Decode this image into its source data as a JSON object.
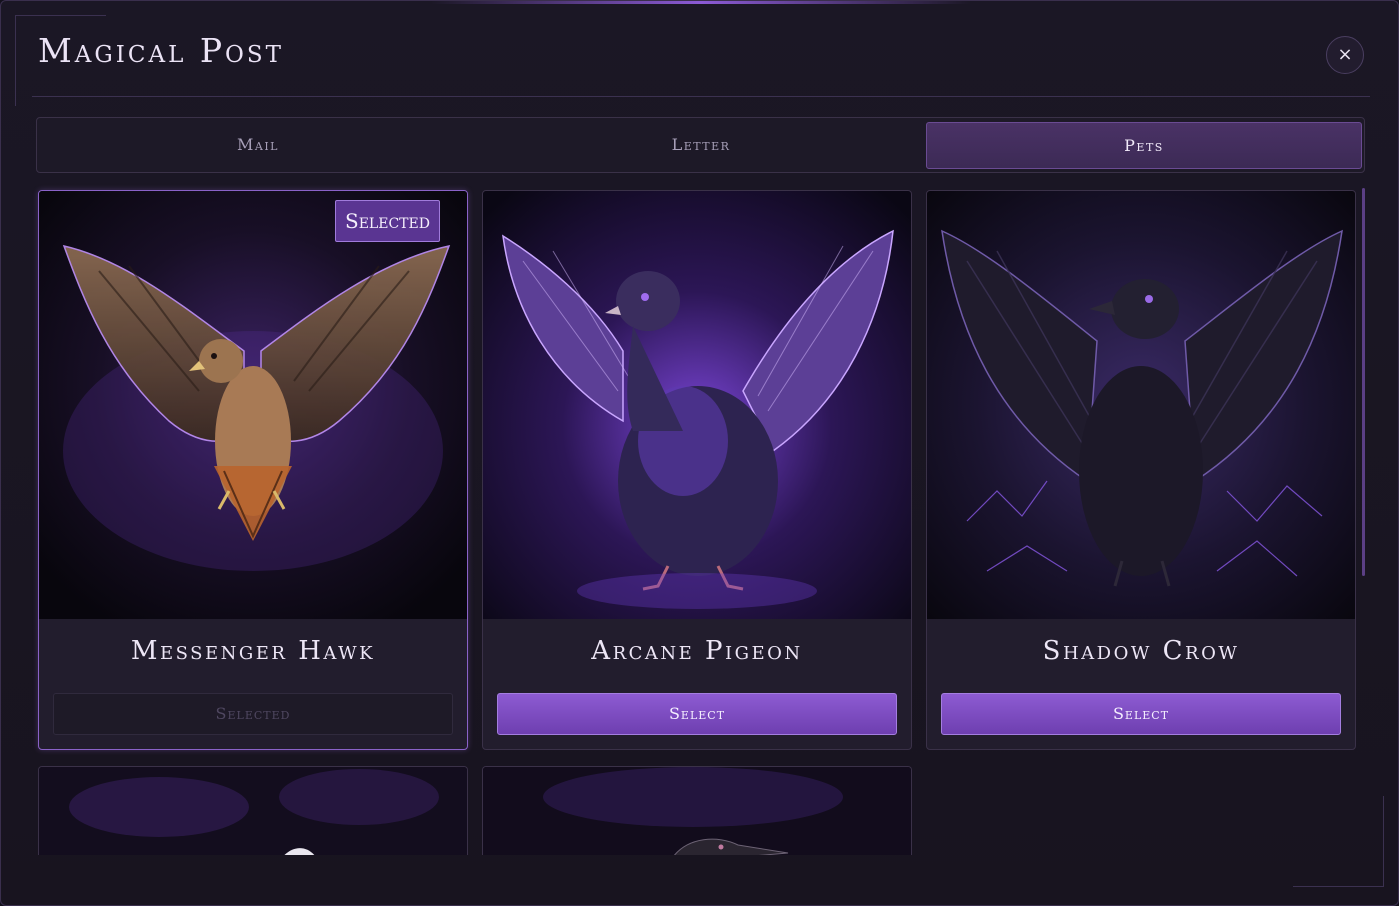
{
  "window": {
    "title": "Magical Post",
    "close_label": "×"
  },
  "tabs": [
    {
      "label": "Mail",
      "active": false
    },
    {
      "label": "Letter",
      "active": false
    },
    {
      "label": "Pets",
      "active": true
    }
  ],
  "pets": [
    {
      "name": "Messenger Hawk",
      "button": "Selected",
      "badge": "Selected",
      "selected": true,
      "icon": "hawk-illustration"
    },
    {
      "name": "Arcane Pigeon",
      "button": "Select",
      "selected": false,
      "icon": "pigeon-illustration"
    },
    {
      "name": "Shadow Crow",
      "button": "Select",
      "selected": false,
      "icon": "crow-illustration"
    },
    {
      "name": "",
      "icon": "owl-illustration"
    },
    {
      "name": "",
      "icon": "cormorant-illustration"
    }
  ],
  "colors": {
    "accent": "#8d5bd2",
    "background": "#18141f",
    "card": "#221d2d",
    "text": "#ede6f6"
  }
}
